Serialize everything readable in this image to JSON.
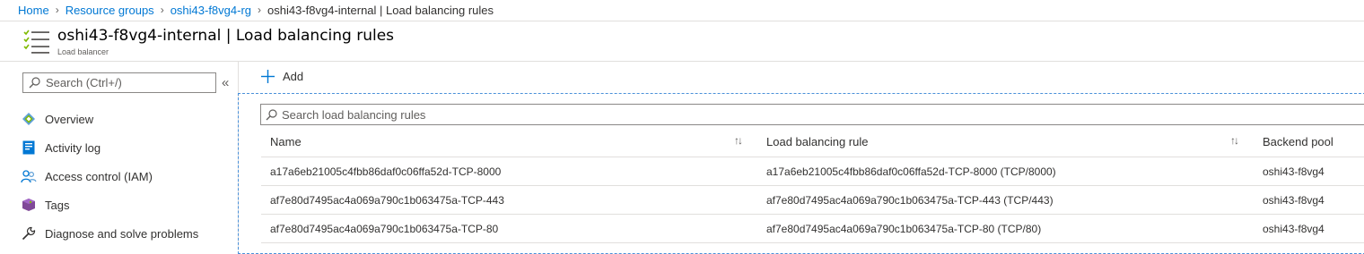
{
  "breadcrumb": {
    "items": [
      "Home",
      "Resource groups",
      "oshi43-f8vg4-rg"
    ],
    "current": "oshi43-f8vg4-internal | Load balancing rules"
  },
  "blade": {
    "title": "oshi43-f8vg4-internal | Load balancing rules",
    "subtitle": "Load balancer",
    "icon": "load-balancer-icon"
  },
  "sidebar": {
    "search_placeholder": "Search (Ctrl+/)",
    "collapse_glyph": "«",
    "items": [
      {
        "label": "Overview",
        "icon": "overview-icon"
      },
      {
        "label": "Activity log",
        "icon": "activity-log-icon"
      },
      {
        "label": "Access control (IAM)",
        "icon": "access-control-icon"
      },
      {
        "label": "Tags",
        "icon": "tag-icon"
      },
      {
        "label": "Diagnose and solve problems",
        "icon": "wrench-icon"
      }
    ]
  },
  "toolbar": {
    "add_label": "Add"
  },
  "grid": {
    "search_placeholder": "Search load balancing rules",
    "columns": [
      "Name",
      "Load balancing rule",
      "Backend pool"
    ],
    "sort_glyph": "↑↓",
    "rows": [
      {
        "name": "a17a6eb21005c4fbb86daf0c06ffa52d-TCP-8000",
        "rule": "a17a6eb21005c4fbb86daf0c06ffa52d-TCP-8000 (TCP/8000)",
        "pool": "oshi43-f8vg4"
      },
      {
        "name": "af7e80d7495ac4a069a790c1b063475a-TCP-443",
        "rule": "af7e80d7495ac4a069a790c1b063475a-TCP-443 (TCP/443)",
        "pool": "oshi43-f8vg4"
      },
      {
        "name": "af7e80d7495ac4a069a790c1b063475a-TCP-80",
        "rule": "af7e80d7495ac4a069a790c1b063475a-TCP-80 (TCP/80)",
        "pool": "oshi43-f8vg4"
      }
    ]
  },
  "colors": {
    "link": "#0078d4",
    "frame": "#4a90d9",
    "border": "#e1dfdd"
  }
}
